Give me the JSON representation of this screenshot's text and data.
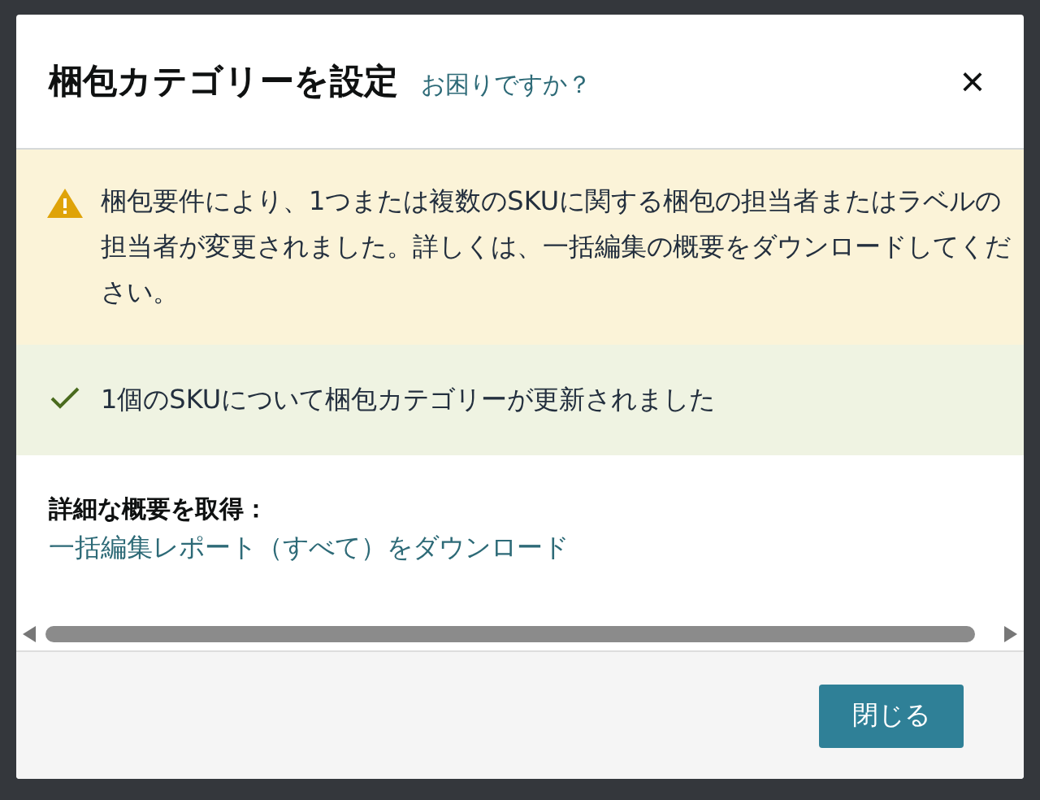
{
  "dialog": {
    "title": "梱包カテゴリーを設定",
    "help_link": "お困りですか？",
    "close": "×"
  },
  "alerts": [
    {
      "kind": "warning",
      "text": "梱包要件により、1つまたは複数のSKUに関する梱包の担当者またはラベルの担当者が変更されました。詳しくは、一括編集の概要をダウンロードしてください。"
    },
    {
      "kind": "success",
      "text": "1個のSKUについて梱包カテゴリーが更新されました"
    }
  ],
  "summary": {
    "heading": "詳細な概要を取得：",
    "link": "一括編集レポート（すべて）をダウンロード"
  },
  "buttons": [
    "閉じる"
  ]
}
